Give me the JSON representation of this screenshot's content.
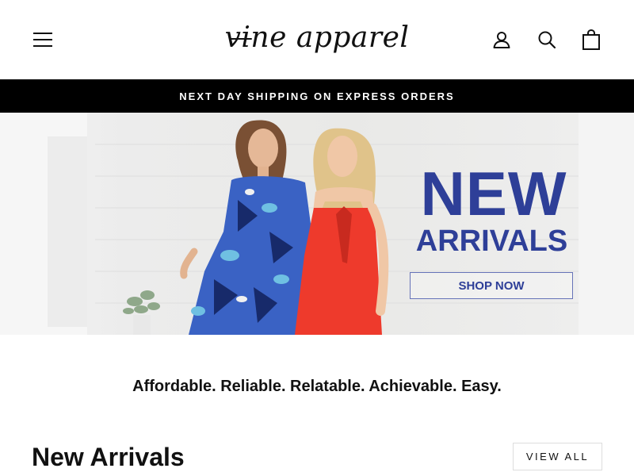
{
  "header": {
    "logo_text": "vine apparel",
    "icons": {
      "menu": "hamburger-menu-icon",
      "account": "user-icon",
      "search": "search-icon",
      "cart": "shopping-bag-icon"
    }
  },
  "promo": {
    "text": "NEXT DAY SHIPPING ON EXPRESS ORDERS"
  },
  "hero": {
    "title": "NEW",
    "subtitle": "ARRIVALS",
    "cta_label": "SHOP NOW",
    "accent_color": "#2e3f98"
  },
  "tagline": "Affordable. Reliable. Relatable. Achievable. Easy.",
  "section": {
    "title": "New Arrivals",
    "view_all_label": "VIEW ALL"
  }
}
